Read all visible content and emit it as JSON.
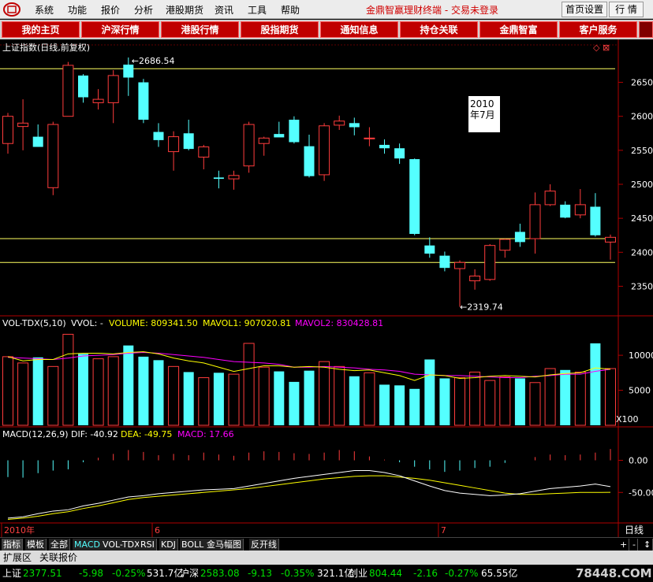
{
  "menubar": {
    "items": [
      "系统",
      "功能",
      "报价",
      "分析",
      "港股期货",
      "资讯",
      "工具",
      "帮助"
    ],
    "app_title": "金鼎智赢理财终端 - 交易未登录",
    "btn_home_settings": "首页设置",
    "btn_quotes": "行 情"
  },
  "navbar": {
    "items": [
      "我的主页",
      "沪深行情",
      "港股行情",
      "股指期货",
      "通知信息",
      "持仓关联",
      "金鼎智富",
      "客户服务"
    ]
  },
  "chart_header": {
    "title": "上证指数(日线,前复权)",
    "symbols": "◇ ⊠"
  },
  "chart_data": [
    {
      "type": "candlestick",
      "title": "上证指数(日线,前复权)",
      "ylim": [
        2310,
        2690
      ],
      "yticks": [
        2650,
        2600,
        2550,
        2500,
        2450,
        2400,
        2350
      ],
      "high_label": "2686.54",
      "low_label": "2319.74",
      "annotation": "2010\n年7月",
      "hlines": [
        2670,
        2420,
        2385
      ],
      "candles": [
        {
          "o": 2560,
          "h": 2605,
          "l": 2545,
          "c": 2600
        },
        {
          "o": 2585,
          "h": 2625,
          "l": 2550,
          "c": 2590
        },
        {
          "o": 2570,
          "h": 2588,
          "l": 2555,
          "c": 2555
        },
        {
          "o": 2495,
          "h": 2592,
          "l": 2484,
          "c": 2588
        },
        {
          "o": 2600,
          "h": 2680,
          "l": 2600,
          "c": 2675
        },
        {
          "o": 2660,
          "h": 2662,
          "l": 2620,
          "c": 2628
        },
        {
          "o": 2620,
          "h": 2640,
          "l": 2610,
          "c": 2625
        },
        {
          "o": 2620,
          "h": 2668,
          "l": 2590,
          "c": 2660
        },
        {
          "o": 2676,
          "h": 2686.54,
          "l": 2630,
          "c": 2657
        },
        {
          "o": 2650,
          "h": 2655,
          "l": 2590,
          "c": 2595
        },
        {
          "o": 2577,
          "h": 2590,
          "l": 2555,
          "c": 2565
        },
        {
          "o": 2548,
          "h": 2578,
          "l": 2520,
          "c": 2570
        },
        {
          "o": 2575,
          "h": 2595,
          "l": 2550,
          "c": 2552
        },
        {
          "o": 2540,
          "h": 2558,
          "l": 2522,
          "c": 2555
        },
        {
          "o": 2510,
          "h": 2520,
          "l": 2494,
          "c": 2508
        },
        {
          "o": 2508,
          "h": 2520,
          "l": 2492,
          "c": 2513
        },
        {
          "o": 2527,
          "h": 2592,
          "l": 2517,
          "c": 2588
        },
        {
          "o": 2560,
          "h": 2570,
          "l": 2542,
          "c": 2568
        },
        {
          "o": 2574,
          "h": 2592,
          "l": 2570,
          "c": 2569
        },
        {
          "o": 2595,
          "h": 2600,
          "l": 2560,
          "c": 2562
        },
        {
          "o": 2556,
          "h": 2573,
          "l": 2510,
          "c": 2512
        },
        {
          "o": 2514,
          "h": 2590,
          "l": 2505,
          "c": 2586
        },
        {
          "o": 2587,
          "h": 2601,
          "l": 2580,
          "c": 2593
        },
        {
          "o": 2590,
          "h": 2598,
          "l": 2572,
          "c": 2584
        },
        {
          "o": 2568,
          "h": 2584,
          "l": 2556,
          "c": 2568
        },
        {
          "o": 2558,
          "h": 2566,
          "l": 2545,
          "c": 2553
        },
        {
          "o": 2553,
          "h": 2560,
          "l": 2530,
          "c": 2538
        },
        {
          "o": 2537,
          "h": 2538,
          "l": 2425,
          "c": 2427
        },
        {
          "o": 2410,
          "h": 2422,
          "l": 2392,
          "c": 2398
        },
        {
          "o": 2395,
          "h": 2401,
          "l": 2372,
          "c": 2377
        },
        {
          "o": 2376,
          "h": 2388,
          "l": 2319.74,
          "c": 2385
        },
        {
          "o": 2358,
          "h": 2375,
          "l": 2345,
          "c": 2365
        },
        {
          "o": 2360,
          "h": 2412,
          "l": 2358,
          "c": 2410
        },
        {
          "o": 2403,
          "h": 2420,
          "l": 2392,
          "c": 2419
        },
        {
          "o": 2430,
          "h": 2442,
          "l": 2408,
          "c": 2415
        },
        {
          "o": 2420,
          "h": 2488,
          "l": 2398,
          "c": 2470
        },
        {
          "o": 2470,
          "h": 2500,
          "l": 2468,
          "c": 2490
        },
        {
          "o": 2470,
          "h": 2475,
          "l": 2450,
          "c": 2451
        },
        {
          "o": 2455,
          "h": 2493,
          "l": 2450,
          "c": 2470
        },
        {
          "o": 2467,
          "h": 2487,
          "l": 2423,
          "c": 2425
        },
        {
          "o": 2415,
          "h": 2426,
          "l": 2389,
          "c": 2422
        }
      ]
    },
    {
      "type": "bar",
      "title": "VOL-TDX(5,10)",
      "legend": [
        {
          "label": "VOLUME: 809341.50",
          "color": "#ffff00"
        },
        {
          "label": "MAVOL1: 907020.81",
          "color": "#ffff00"
        },
        {
          "label": "MAVOL2: 830428.81",
          "color": "#ff00ff"
        }
      ],
      "prefix": "VVOL: -",
      "yticks": [
        10000,
        5000
      ],
      "unit_label": "X100",
      "ylim": [
        0,
        13500
      ],
      "values": [
        9800,
        8900,
        9700,
        8400,
        13000,
        10200,
        9500,
        9800,
        11400,
        9800,
        9300,
        8400,
        7600,
        6800,
        7500,
        7300,
        11700,
        8300,
        7700,
        6200,
        7800,
        9100,
        8400,
        7000,
        7500,
        5800,
        5700,
        5200,
        9400,
        6700,
        6800,
        7600,
        6400,
        6900,
        6700,
        6100,
        8100,
        7900,
        7600,
        11700,
        8100
      ],
      "mavol1": [
        9800,
        9200,
        9400,
        9400,
        10200,
        10300,
        10300,
        10200,
        10400,
        10500,
        10200,
        9600,
        9200,
        8900,
        8300,
        7700,
        8100,
        8500,
        8500,
        8300,
        8400,
        8300,
        8000,
        7800,
        7900,
        7500,
        7100,
        6400,
        7200,
        7100,
        6700,
        6800,
        7000,
        7100,
        7000,
        6900,
        7200,
        7400,
        7500,
        8200,
        8000
      ],
      "mavol2": [
        9700,
        9600,
        9500,
        9400,
        9600,
        9900,
        10000,
        10100,
        10300,
        10400,
        10300,
        10100,
        9900,
        9700,
        9400,
        9100,
        9000,
        8900,
        8700,
        8300,
        8300,
        8400,
        8300,
        8200,
        8000,
        7900,
        7700,
        7300,
        7200,
        7100,
        7100,
        7000,
        6900,
        6800,
        6800,
        7000,
        7100,
        7300,
        7300,
        7700,
        8000
      ]
    },
    {
      "type": "line",
      "title": "MACD(12,26,9)",
      "legend": [
        {
          "label": "DIF: -40.92",
          "color": "#ffffff"
        },
        {
          "label": "DEA: -49.75",
          "color": "#ffff00"
        },
        {
          "label": "MACD: 17.66",
          "color": "#ff00ff"
        }
      ],
      "yticks": [
        0,
        -50
      ],
      "ylim": [
        -95,
        30
      ],
      "macd": [
        -26,
        -27,
        -20,
        -16,
        -14,
        -3,
        4,
        10,
        16,
        13,
        8,
        10,
        8,
        12,
        9,
        7,
        12,
        14,
        13,
        11,
        10,
        12,
        16,
        14,
        6,
        1,
        -3,
        -10,
        -14,
        -18,
        -16,
        -12,
        -10,
        -4,
        0,
        5,
        9,
        8,
        9,
        12,
        17.66
      ],
      "dif": [
        -90,
        -88,
        -83,
        -79,
        -77,
        -71,
        -67,
        -62,
        -57,
        -55,
        -52,
        -50,
        -48,
        -46,
        -45,
        -44,
        -40,
        -36,
        -32,
        -28,
        -25,
        -22,
        -19,
        -16,
        -16,
        -19,
        -24,
        -32,
        -40,
        -47,
        -51,
        -53,
        -55,
        -54,
        -52,
        -48,
        -44,
        -42,
        -40,
        -37,
        -40.92
      ],
      "dea": [
        -92,
        -90,
        -87,
        -83,
        -80,
        -75,
        -71,
        -66,
        -61,
        -58,
        -56,
        -54,
        -52,
        -50,
        -48,
        -46,
        -44,
        -41,
        -38,
        -35,
        -32,
        -29,
        -27,
        -25,
        -24,
        -24,
        -26,
        -28,
        -31,
        -35,
        -39,
        -43,
        -47,
        -51,
        -53,
        -53,
        -52,
        -51,
        -50,
        -50,
        -49.75
      ]
    }
  ],
  "xaxis": {
    "labels": [
      {
        "text": "2010年",
        "index": 0
      },
      {
        "text": "6",
        "index": 10
      },
      {
        "text": "7",
        "index": 29
      }
    ],
    "period": "日线",
    "btns": [
      "+",
      "-",
      "↕"
    ]
  },
  "tabs": [
    "指标",
    "模板",
    "全部",
    "MACD",
    "VOL-TDX",
    "RSI",
    "KDJ",
    "BOLL",
    "金马幅图",
    "反开线"
  ],
  "ext_tabs": [
    "扩展区",
    "关联报价"
  ],
  "statusbar": {
    "sh_name": "上证",
    "sh_value": "2377.51",
    "sh_change": "-5.98",
    "sh_pct": "-0.25%",
    "sh_amount": "531.7亿",
    "hs_name": "沪深",
    "hs_value": "2583.08",
    "hs_change": "-9.13",
    "hs_pct": "-0.35%",
    "hs_amount": "321.1亿",
    "cy_name": "创业",
    "cy_value": "804.44",
    "cy_change": "-2.16",
    "cy_pct": "-0.27%",
    "cy_amount": "65.55亿",
    "watermark": "78448.COM"
  },
  "colors": {
    "up": "#ff3c3c",
    "down": "#54ffff",
    "axis": "#b00000",
    "hline": "#ffff60",
    "grid": "#8b0000"
  }
}
